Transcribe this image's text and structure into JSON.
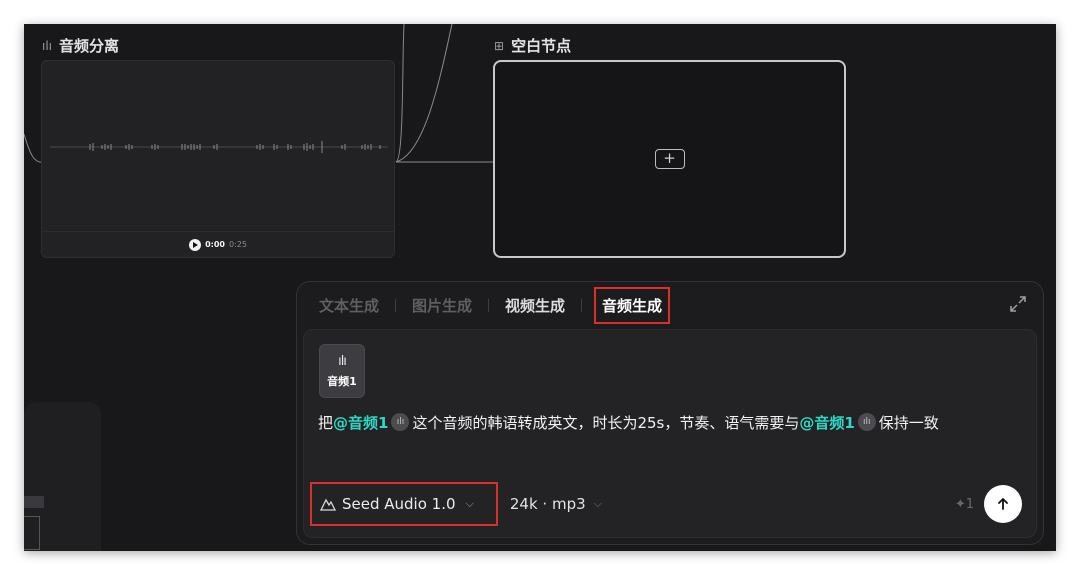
{
  "canvas": {
    "audio_node": {
      "icon": "audio-wave-icon",
      "title": "音频分离",
      "player": {
        "current_time": "0:00",
        "duration": "0:25"
      }
    },
    "blank_node": {
      "icon": "add-box-icon",
      "title": "空白节点"
    }
  },
  "panel": {
    "tabs": [
      {
        "label": "文本生成"
      },
      {
        "label": "图片生成"
      },
      {
        "label": "视频生成"
      },
      {
        "label": "音频生成"
      }
    ],
    "selected_tab": "音频生成",
    "attachment": {
      "label": "音频1",
      "icon": "audio-wave-icon"
    },
    "prompt": {
      "seg1": "把",
      "mention1": "@音频1",
      "seg2": "这个音频的韩语转成英文，时长为25s，节奏、语气需要与",
      "mention2": "@音频1",
      "seg3": "保持一致"
    },
    "toolbar": {
      "model_label": "Seed Audio 1.0",
      "model_icon": "mountain-icon",
      "format_label": "24k · mp3",
      "credit_value": "1",
      "credit_icon": "sparkle-icon",
      "send_icon": "arrow-up-icon"
    }
  },
  "colors": {
    "canvas_bg": "#18181a",
    "accent_mention": "#2fd8c3",
    "highlight_red": "#d9302c"
  }
}
